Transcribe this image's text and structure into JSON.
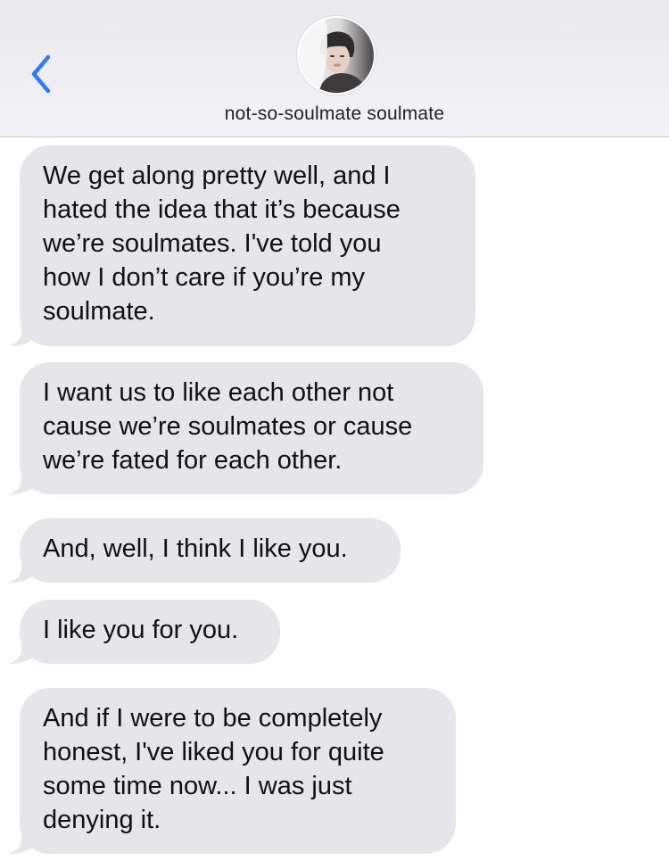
{
  "header": {
    "back_icon": "chevron-left-icon",
    "contact_name": "not-so-soulmate soulmate",
    "accent_color": "#2f7cf6"
  },
  "messages": [
    {
      "lines": [
        "We get along pretty well, and I",
        "hated the idea that it’s because",
        "we’re soulmates. I've told you",
        "how I don’t care if you’re my",
        "soulmate."
      ]
    },
    {
      "lines": [
        "I want us to like each other not",
        "cause we’re soulmates or cause",
        "we’re fated for each other."
      ]
    },
    {
      "lines": [
        "And, well, I think I like you."
      ]
    },
    {
      "lines": [
        "I like you for you."
      ]
    },
    {
      "lines": [
        "And if I were to be completely",
        "honest, I've liked you for quite",
        "some time now... I was just",
        "denying it."
      ]
    }
  ],
  "colors": {
    "incoming_bubble": "#e5e5ea",
    "header_bg": "#ececf0"
  }
}
